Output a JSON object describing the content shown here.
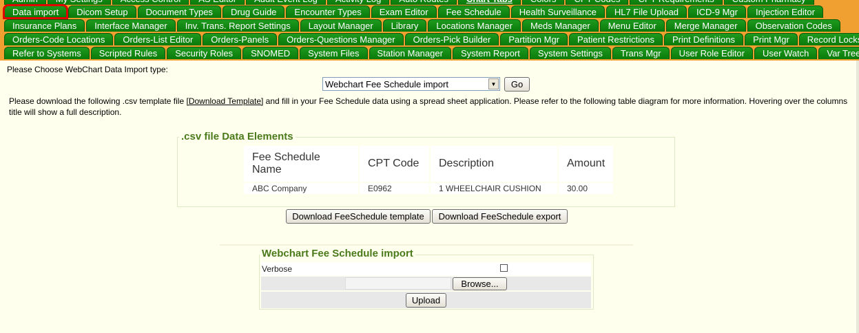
{
  "tabs": {
    "row0": [
      "Admin",
      "My Settings",
      "Access Control",
      "AS Editor",
      "Audit Event Log",
      "Activity Log",
      "Auto Routes",
      "Chart Tabs",
      "Colors",
      "CPT Codes",
      "CPT Requirements",
      "Custom Pharmacy"
    ],
    "row1": [
      "Data import",
      "Dicom Setup",
      "Document Types",
      "Drug Guide",
      "Encounter Types",
      "Exam Editor",
      "Fee Schedule",
      "Health Surveillance",
      "HL7 File Upload",
      "ICD-9 Mgr",
      "Injection Editor"
    ],
    "row2": [
      "Insurance Plans",
      "Interface Manager",
      "Inv. Trans. Report Settings",
      "Layout Manager",
      "Library",
      "Locations Manager",
      "Meds Manager",
      "Menu Editor",
      "Merge Manager",
      "Observation Codes"
    ],
    "row3": [
      "Orders-Code Locations",
      "Orders-List Editor",
      "Orders-Panels",
      "Orders-Questions Manager",
      "Orders-Pick Builder",
      "Partition Mgr",
      "Patient Restrictions",
      "Print Definitions",
      "Print Mgr",
      "Record Locks"
    ],
    "row4": [
      "Refer to Systems",
      "Scripted Rules",
      "Security Roles",
      "SNOMED",
      "System Files",
      "Station Manager",
      "System Report",
      "System Settings",
      "Trans Mgr",
      "User Role Editor",
      "User Watch",
      "Var Tree"
    ]
  },
  "choose_label": "Please Choose WebChart Data Import type:",
  "import_select": {
    "selected": "Webchart Fee Schedule import"
  },
  "go_label": "Go",
  "instructions": {
    "before": "Please download the following .csv template file ",
    "link": "[Download Template]",
    "after": " and fill in your Fee Schedule data using a spread sheet application. Please refer to the following table diagram for more information. Hovering over the columns title will show a full description."
  },
  "data_elements": {
    "legend": ".csv file Data Elements",
    "columns": [
      "Fee Schedule Name",
      "CPT Code",
      "Description",
      "Amount"
    ],
    "rows": [
      [
        "ABC Company",
        "E0962",
        "1 WHEELCHAIR CUSHION",
        "30.00"
      ]
    ]
  },
  "download_template_label": "Download FeeSchedule template",
  "download_export_label": "Download FeeSchedule export",
  "import_box": {
    "legend": "Webchart Fee Schedule import",
    "verbose_label": "Verbose",
    "browse_label": "Browse...",
    "upload_label": "Upload"
  },
  "colors": {
    "tab_green": "#0a7a0a",
    "tabbar_orange": "#f0a030",
    "legend_green": "#4a7a1a",
    "background": "#ffffee"
  }
}
